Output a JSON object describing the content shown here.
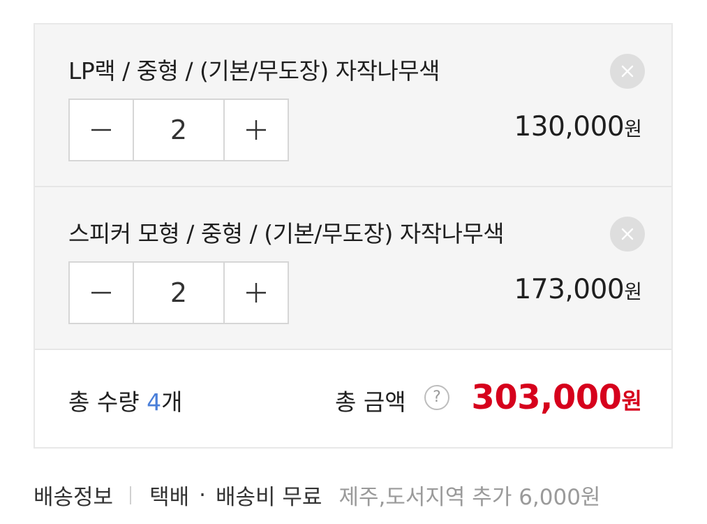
{
  "items": [
    {
      "title": "LP랙 / 중형 / (기본/무도장) 자작나무색",
      "quantity": "2",
      "price": "130,000",
      "price_unit": "원"
    },
    {
      "title": "스피커 모형 / 중형 / (기본/무도장) 자작나무색",
      "quantity": "2",
      "price": "173,000",
      "price_unit": "원"
    }
  ],
  "summary": {
    "total_qty_label": "총 수량 ",
    "total_qty_count": "4",
    "total_qty_suffix": "개",
    "total_amount_label": "총 금액",
    "help_glyph": "?",
    "total_amount": "303,000",
    "total_amount_unit": "원"
  },
  "shipping": {
    "label": "배송정보",
    "method": "택배",
    "separator": "·",
    "fee": "배송비 무료",
    "extra": "제주,도서지역 추가 6,000원"
  },
  "icons": {
    "remove": "close-icon",
    "decrease": "minus-icon",
    "increase": "plus-icon",
    "help": "question-circle-icon"
  },
  "colors": {
    "accent_blue": "#4a7fd9",
    "price_red": "#d6001c",
    "panel_bg": "#f5f5f5"
  }
}
